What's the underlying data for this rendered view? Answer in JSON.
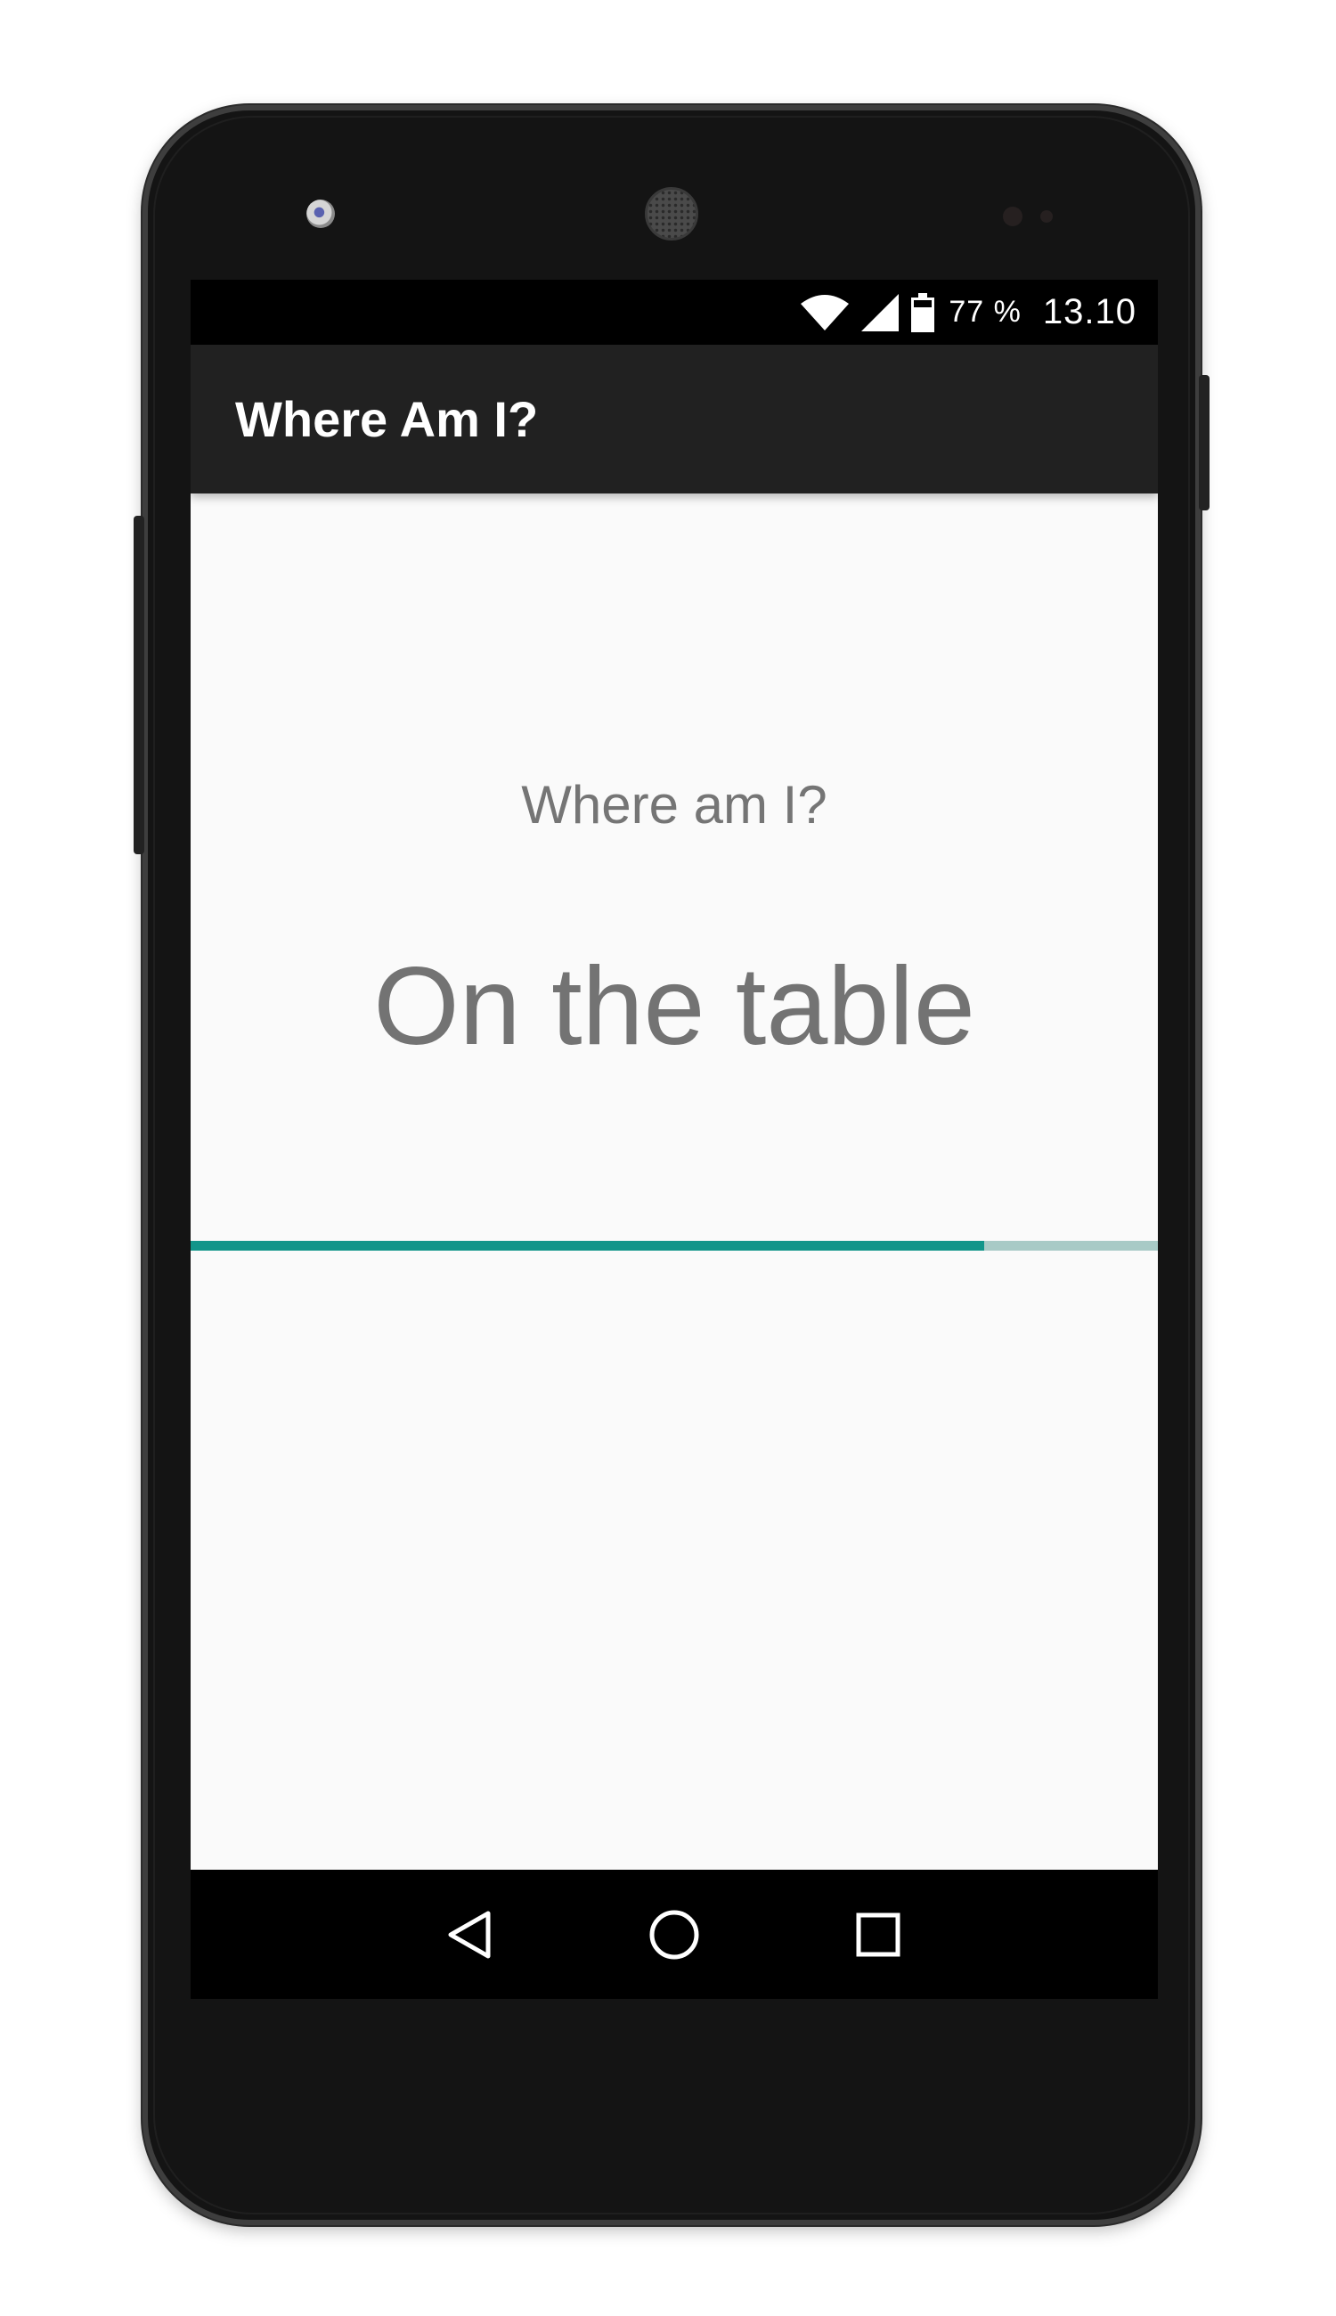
{
  "status_bar": {
    "icons": [
      "wifi-icon",
      "cell-signal-icon",
      "battery-icon"
    ],
    "battery_percent": "77 %",
    "battery_level": 0.77,
    "time": "13.10"
  },
  "app_bar": {
    "title": "Where Am I?",
    "background_color": "#212121"
  },
  "content": {
    "question": "Where am I?",
    "answer": "On the table",
    "text_color": "#757575"
  },
  "progress": {
    "value": 0.82,
    "fill_color": "#12958a",
    "track_color": "#a8cac6"
  },
  "nav_bar": {
    "buttons": [
      "back-icon",
      "home-icon",
      "recents-icon"
    ]
  }
}
